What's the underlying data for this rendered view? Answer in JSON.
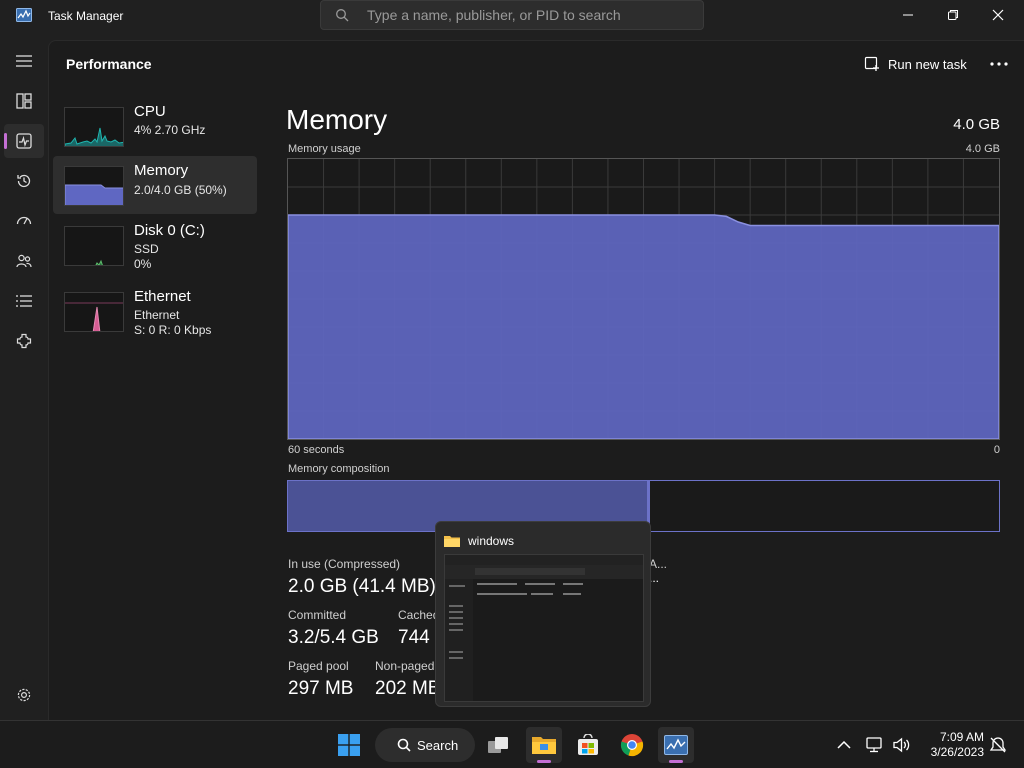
{
  "window": {
    "title": "Task Manager"
  },
  "search": {
    "placeholder": "Type a name, publisher, or PID to search"
  },
  "header": {
    "page_title": "Performance",
    "run_new_task": "Run new task"
  },
  "perf_list": [
    {
      "name": "CPU",
      "line1": "4% 2.70 GHz",
      "line2": ""
    },
    {
      "name": "Memory",
      "line1": "2.0/4.0 GB (50%)",
      "line2": ""
    },
    {
      "name": "Disk 0 (C:)",
      "line1": "SSD",
      "line2": "0%"
    },
    {
      "name": "Ethernet",
      "line1": "Ethernet",
      "line2": "S: 0 R: 0 Kbps"
    }
  ],
  "detail": {
    "title": "Memory",
    "total": "4.0 GB",
    "usage_label": "Memory usage",
    "usage_max": "4.0 GB",
    "time_left": "60 seconds",
    "time_right": "0",
    "composition_label": "Memory composition",
    "composition_in_use_fraction": 0.505,
    "usage_series_gb": [
      3.2,
      3.2,
      3.2,
      3.2,
      3.2,
      3.2,
      3.2,
      3.2,
      3.2,
      3.2,
      3.2,
      3.2,
      3.2,
      3.2,
      3.2,
      3.2,
      3.2,
      3.2,
      3.2,
      3.2,
      3.2,
      3.2,
      3.2,
      3.2,
      3.2,
      3.2,
      3.2,
      3.2,
      3.2,
      3.2,
      3.2,
      3.2,
      3.2,
      3.2,
      3.2,
      3.2,
      3.2,
      3.18,
      3.1,
      3.05,
      3.05,
      3.05,
      3.05,
      3.05,
      3.05,
      3.05,
      3.05,
      3.05,
      3.05,
      3.05,
      3.05,
      3.05,
      3.05,
      3.05,
      3.05,
      3.05,
      3.05,
      3.05,
      3.05,
      3.05,
      3.05
    ],
    "usage_max_gb": 4.0
  },
  "stats": {
    "in_use_label": "In use (Compressed)",
    "in_use_value": "2.0 GB (41.4 MB)",
    "available_label": "A...",
    "available_value": "...",
    "committed_label": "Committed",
    "committed_value": "3.2/5.4 GB",
    "cached_label": "Cached",
    "cached_value": "744",
    "paged_label": "Paged pool",
    "paged_value": "297 MB",
    "nonpaged_label": "Non-paged",
    "nonpaged_value": "202 MB"
  },
  "preview": {
    "title": "windows"
  },
  "taskbar": {
    "search_label": "Search",
    "time": "7:09 AM",
    "date": "3/26/2023"
  },
  "colors": {
    "accent": "#c46fd4",
    "memory": "#6c72c8",
    "memory_fill": "#5f67c2",
    "cpu": "#1fb6b0",
    "ethernet": "#d65d94"
  }
}
